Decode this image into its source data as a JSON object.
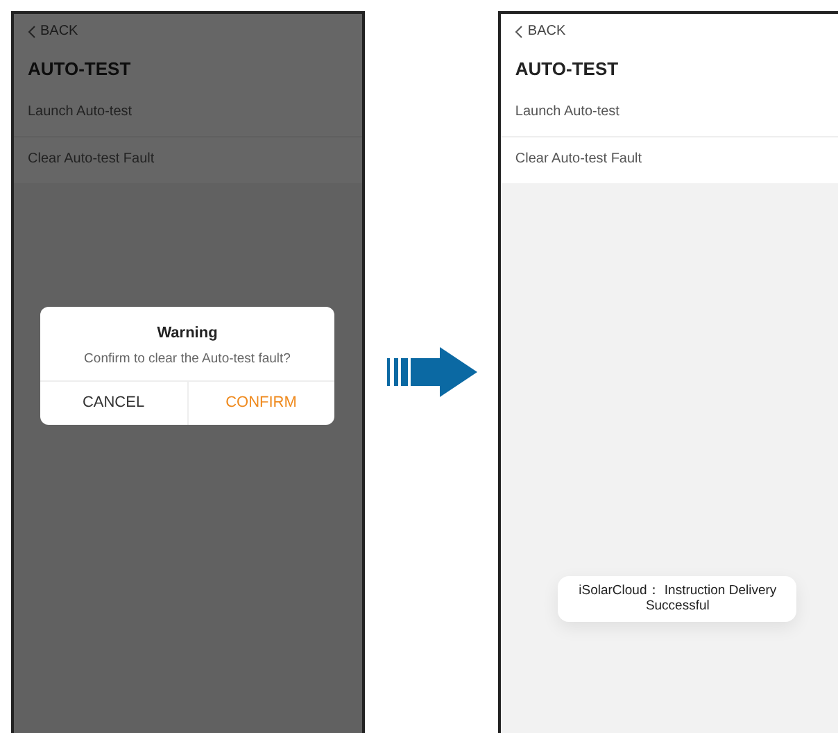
{
  "screens": [
    {
      "back": "BACK",
      "title": "AUTO-TEST",
      "items": [
        "Launch Auto-test",
        "Clear Auto-test Fault"
      ],
      "dimmed": true,
      "dialog": {
        "title": "Warning",
        "message": "Confirm to clear the Auto-test fault?",
        "buttons": [
          {
            "label": "CANCEL",
            "kind": "cancel"
          },
          {
            "label": "CONFIRM",
            "kind": "confirm"
          }
        ]
      }
    },
    {
      "back": "BACK",
      "title": "AUTO-TEST",
      "items": [
        "Launch Auto-test",
        "Clear Auto-test Fault"
      ],
      "dimmed": false,
      "toast": "iSolarCloud： Instruction Delivery Successful"
    }
  ]
}
